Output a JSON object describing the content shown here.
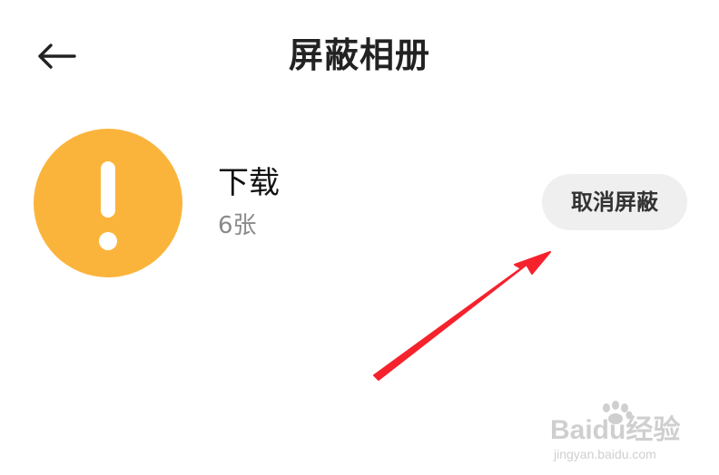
{
  "header": {
    "title": "屏蔽相册",
    "back_icon": "back-arrow-icon"
  },
  "album": {
    "name": "下载",
    "count": "6张",
    "thumb_icon": "exclamation-icon",
    "thumb_color": "#FBB43B",
    "action_label": "取消屏蔽"
  },
  "annotation": {
    "arrow_color": "#F5222D"
  },
  "watermark": {
    "brand_text": "Baidu经验",
    "url": "jingyan.baidu.com"
  }
}
